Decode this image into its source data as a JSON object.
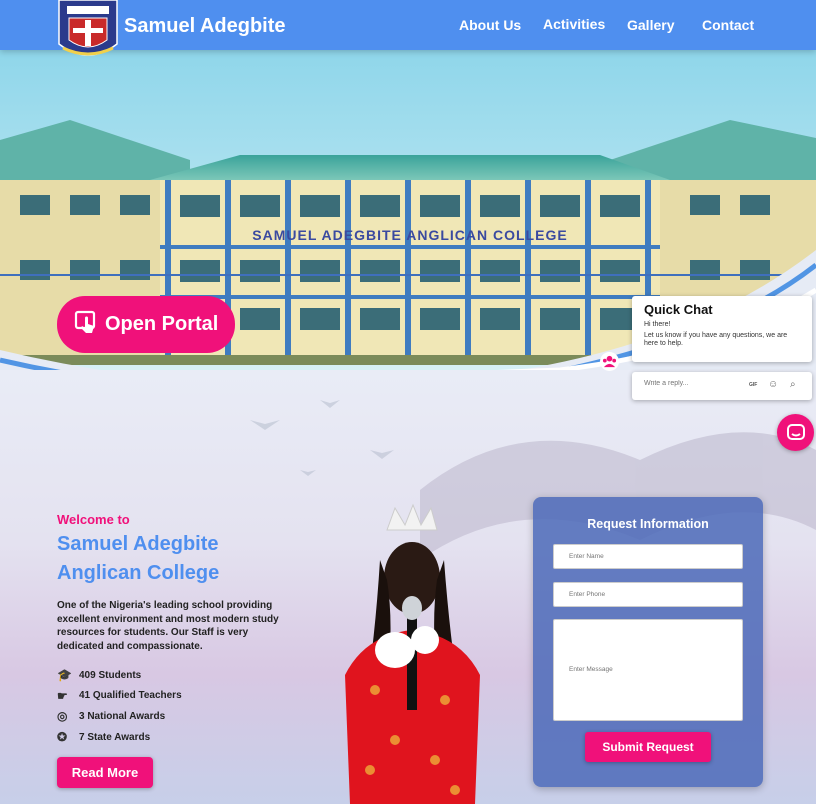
{
  "header": {
    "brand": "Samuel Adegbite",
    "nav": [
      "About Us",
      "Activities",
      "Gallery",
      "Contact"
    ]
  },
  "hero": {
    "building_sign": "SAMUEL ADEGBITE ANGLICAN COLLEGE",
    "portal_label": "Open Portal"
  },
  "chat": {
    "title": "Quick Chat",
    "greeting": "Hi there!",
    "message": "Let us know if you have any questions, we are here to help.",
    "reply_placeholder": "Write a reply...",
    "gif_label": "GIF"
  },
  "welcome": {
    "kicker": "Welcome to",
    "college_line1": "Samuel Adegbite",
    "college_line2": "Anglican College",
    "description": "One of the Nigeria's leading school providing excellent environment and most modern study resources for students. Our Staff is very dedicated and compassionate.",
    "stats": [
      "409 Students",
      "41 Qualified Teachers",
      "3 National Awards",
      "7 State Awards"
    ],
    "read_more": "Read More"
  },
  "form": {
    "title": "Request Information",
    "name_placeholder": "Enter Name",
    "phone_placeholder": "Enter Phone",
    "message_placeholder": "Enter Message",
    "submit": "Submit Request"
  },
  "colors": {
    "primary": "#4f8fef",
    "accent": "#f0117a",
    "form_bg": "#4c6ab9"
  }
}
